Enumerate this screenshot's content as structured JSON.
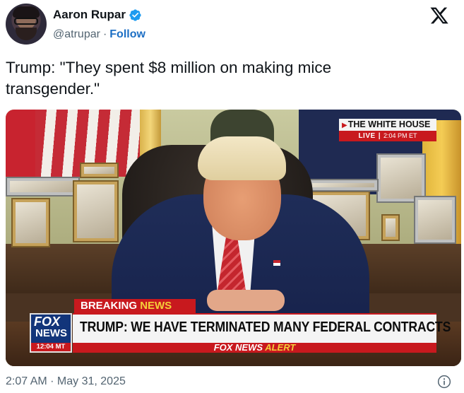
{
  "tweet": {
    "author_name": "Aaron Rupar",
    "handle": "@atrupar",
    "separator": "·",
    "follow_label": "Follow",
    "text": "Trump: \"They spent $8 million on making mice transgender.\"",
    "timestamp": "2:07 AM · May 31, 2025"
  },
  "broadcast": {
    "live_source": "THE WHITE HOUSE",
    "live_label": "LIVE",
    "live_time": "2:04 PM ET",
    "breaking_word1": "BREAKING",
    "breaking_word2": "NEWS",
    "headline": "TRUMP: WE HAVE TERMINATED MANY FEDERAL CONTRACTS",
    "alert_brand": "FOX NEWS",
    "alert_word": "ALERT",
    "logo_line1": "FOX",
    "logo_line2": "NEWS",
    "logo_time": "12:04 MT"
  },
  "colors": {
    "follow_blue": "#1d6fc4",
    "verified_blue": "#1d9bf0",
    "fox_red": "#c8191e",
    "fox_blue": "#12357a",
    "alert_yellow": "#f5cf3a"
  },
  "icons": {
    "verified": "verified-badge-icon",
    "brand": "x-logo-icon",
    "info": "info-icon"
  }
}
